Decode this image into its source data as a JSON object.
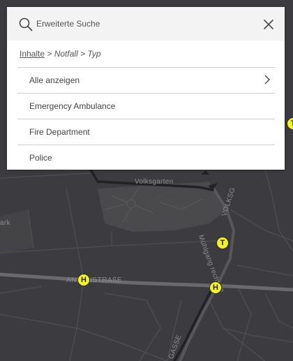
{
  "search": {
    "placeholder": "Erweiterte Suche",
    "value": ""
  },
  "breadcrumb": {
    "root": "Inhalte",
    "sep1": " > ",
    "level1": "Notfall",
    "sep2": " > ",
    "level2": "Typ"
  },
  "list": {
    "show_all": "Alle anzeigen",
    "items": [
      "Emergency Ambulance",
      "Fire Department",
      "Police"
    ]
  },
  "map": {
    "labels": {
      "park": "Volksgarten",
      "street_annenstrasse": "ANNENSTRAßE",
      "street_muehlgang": "Mühlgang rechts 2",
      "street_volksgarten": "VOLKSG",
      "street_gasse": "GASSE",
      "left_park": "ark"
    },
    "markers": {
      "t": "T",
      "h": "H"
    }
  },
  "colors": {
    "map_background": "#3c3b3f",
    "marker_fill": "#f4f41a",
    "panel_background": "#ffffff",
    "search_background": "#f3f3f3"
  }
}
